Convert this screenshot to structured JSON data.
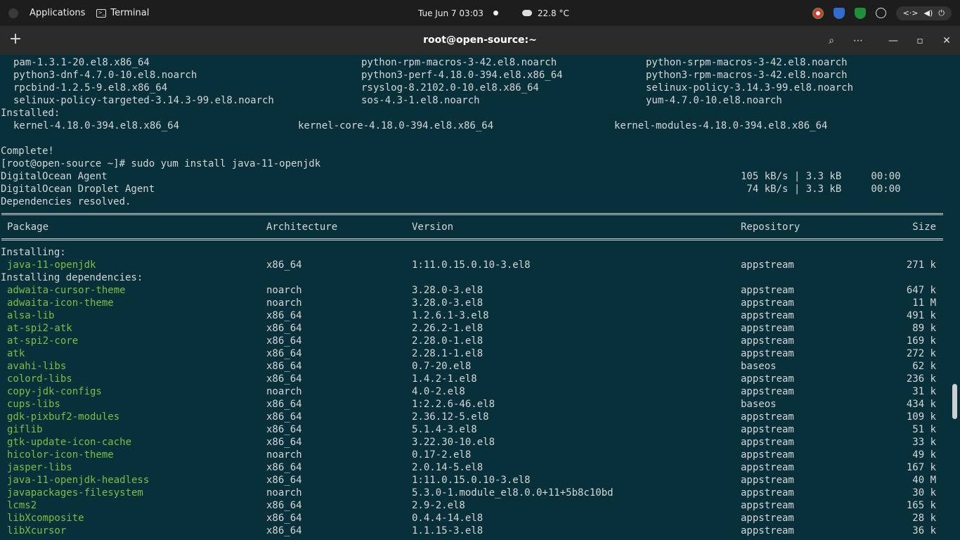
{
  "topbar": {
    "applications": "Applications",
    "terminal": "Terminal",
    "datetime": "Tue Jun 7  03:03",
    "weather": "22.8 °C"
  },
  "window": {
    "title": "root@open-source:~",
    "new_tab": "+",
    "search": "⌕",
    "menu": "⋯",
    "minimize": "—",
    "maximize": "▫",
    "close": "✕"
  },
  "terminal": {
    "columns3": [
      [
        "pam-1.3.1-20.el8.x86_64",
        "python-rpm-macros-3-42.el8.noarch",
        "python-srpm-macros-3-42.el8.noarch"
      ],
      [
        "python3-dnf-4.7.0-10.el8.noarch",
        "python3-perf-4.18.0-394.el8.x86_64",
        "python3-rpm-macros-3-42.el8.noarch"
      ],
      [
        "rpcbind-1.2.5-9.el8.x86_64",
        "rsyslog-8.2102.0-10.el8.x86_64",
        "selinux-policy-3.14.3-99.el8.noarch"
      ],
      [
        "selinux-policy-targeted-3.14.3-99.el8.noarch",
        "sos-4.3-1.el8.noarch",
        "yum-4.7.0-10.el8.noarch"
      ]
    ],
    "installed_label": "Installed:",
    "installed": [
      "kernel-4.18.0-394.el8.x86_64",
      "kernel-core-4.18.0-394.el8.x86_64",
      "kernel-modules-4.18.0-394.el8.x86_64"
    ],
    "complete": "Complete!",
    "prompt": "[root@open-source ~]# sudo yum install java-11-openjdk",
    "repos": [
      {
        "name": "DigitalOcean Agent",
        "stats": "105 kB/s | 3.3 kB     00:00"
      },
      {
        "name": "DigitalOcean Droplet Agent",
        "stats": " 74 kB/s | 3.3 kB     00:00"
      }
    ],
    "deps_resolved": "Dependencies resolved.",
    "headers": {
      "package": "Package",
      "arch": "Architecture",
      "version": "Version",
      "repo": "Repository",
      "size": "Size"
    },
    "installing_label": "Installing:",
    "installing": [
      {
        "package": "java-11-openjdk",
        "arch": "x86_64",
        "version": "1:11.0.15.0.10-3.el8",
        "repo": "appstream",
        "size": "271 k"
      }
    ],
    "deps_label": "Installing dependencies:",
    "deps": [
      {
        "package": "adwaita-cursor-theme",
        "arch": "noarch",
        "version": "3.28.0-3.el8",
        "repo": "appstream",
        "size": "647 k"
      },
      {
        "package": "adwaita-icon-theme",
        "arch": "noarch",
        "version": "3.28.0-3.el8",
        "repo": "appstream",
        "size": "11 M"
      },
      {
        "package": "alsa-lib",
        "arch": "x86_64",
        "version": "1.2.6.1-3.el8",
        "repo": "appstream",
        "size": "491 k"
      },
      {
        "package": "at-spi2-atk",
        "arch": "x86_64",
        "version": "2.26.2-1.el8",
        "repo": "appstream",
        "size": "89 k"
      },
      {
        "package": "at-spi2-core",
        "arch": "x86_64",
        "version": "2.28.0-1.el8",
        "repo": "appstream",
        "size": "169 k"
      },
      {
        "package": "atk",
        "arch": "x86_64",
        "version": "2.28.1-1.el8",
        "repo": "appstream",
        "size": "272 k"
      },
      {
        "package": "avahi-libs",
        "arch": "x86_64",
        "version": "0.7-20.el8",
        "repo": "baseos",
        "size": "62 k"
      },
      {
        "package": "colord-libs",
        "arch": "x86_64",
        "version": "1.4.2-1.el8",
        "repo": "appstream",
        "size": "236 k"
      },
      {
        "package": "copy-jdk-configs",
        "arch": "noarch",
        "version": "4.0-2.el8",
        "repo": "appstream",
        "size": "31 k"
      },
      {
        "package": "cups-libs",
        "arch": "x86_64",
        "version": "1:2.2.6-46.el8",
        "repo": "baseos",
        "size": "434 k"
      },
      {
        "package": "gdk-pixbuf2-modules",
        "arch": "x86_64",
        "version": "2.36.12-5.el8",
        "repo": "appstream",
        "size": "109 k"
      },
      {
        "package": "giflib",
        "arch": "x86_64",
        "version": "5.1.4-3.el8",
        "repo": "appstream",
        "size": "51 k"
      },
      {
        "package": "gtk-update-icon-cache",
        "arch": "x86_64",
        "version": "3.22.30-10.el8",
        "repo": "appstream",
        "size": "33 k"
      },
      {
        "package": "hicolor-icon-theme",
        "arch": "noarch",
        "version": "0.17-2.el8",
        "repo": "appstream",
        "size": "49 k"
      },
      {
        "package": "jasper-libs",
        "arch": "x86_64",
        "version": "2.0.14-5.el8",
        "repo": "appstream",
        "size": "167 k"
      },
      {
        "package": "java-11-openjdk-headless",
        "arch": "x86_64",
        "version": "1:11.0.15.0.10-3.el8",
        "repo": "appstream",
        "size": "40 M"
      },
      {
        "package": "javapackages-filesystem",
        "arch": "noarch",
        "version": "5.3.0-1.module_el8.0.0+11+5b8c10bd",
        "repo": "appstream",
        "size": "30 k"
      },
      {
        "package": "lcms2",
        "arch": "x86_64",
        "version": "2.9-2.el8",
        "repo": "appstream",
        "size": "165 k"
      },
      {
        "package": "libXcomposite",
        "arch": "x86_64",
        "version": "0.4.4-14.el8",
        "repo": "appstream",
        "size": "28 k"
      },
      {
        "package": "libXcursor",
        "arch": "x86_64",
        "version": "1.1.15-3.el8",
        "repo": "appstream",
        "size": "36 k"
      }
    ]
  }
}
